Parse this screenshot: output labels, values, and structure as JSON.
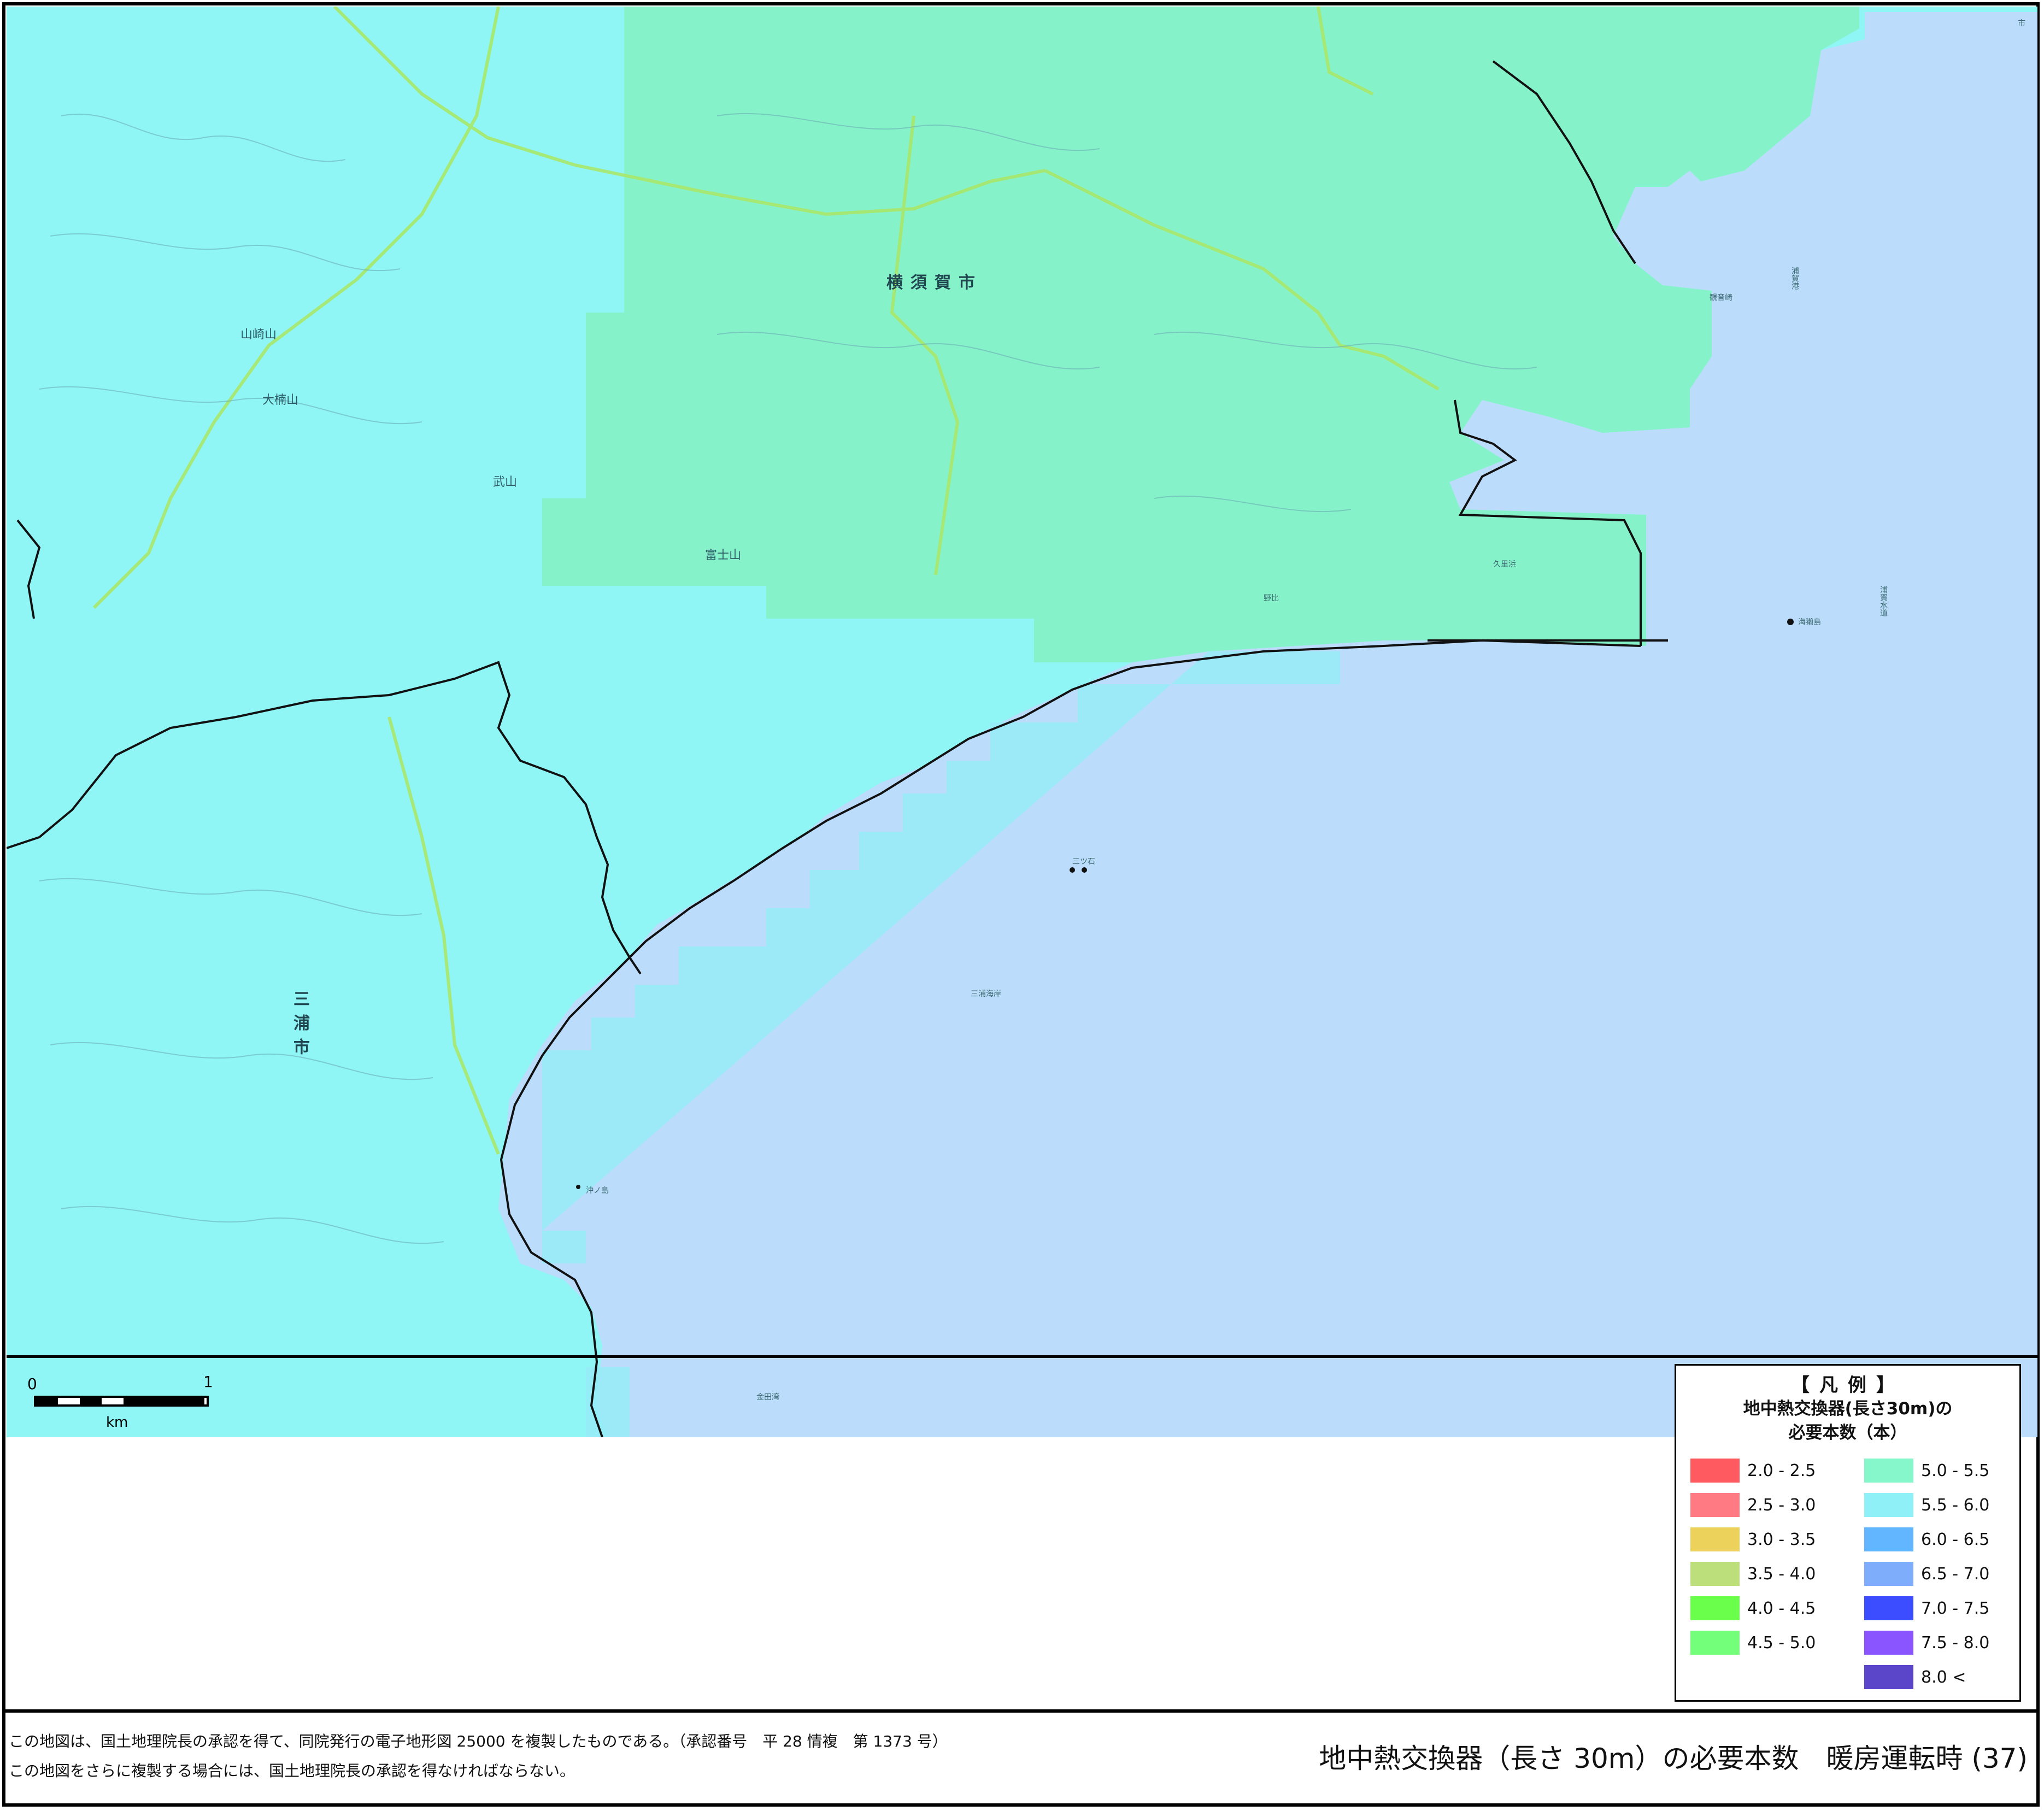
{
  "map": {
    "sheet_number_corner": "市",
    "place_labels": {
      "yokosuka": "横須賀市",
      "miura": "三浦市",
      "takeyama": "武山",
      "ogusuyama": "大楠山",
      "yamazakiyama": "山崎山",
      "fujiyama": "富士山",
      "miurakaigan": "三浦海岸",
      "kanadawan": "金田湾",
      "okinoshima": "沖ノ島",
      "mitsuishi": "三ツ石",
      "ashikajima": "海獺島",
      "uragasuido": "浦賀水道",
      "uragako": "浦賀港",
      "kannonzaki": "観音崎",
      "nojima": "野比",
      "kurihama": "久里浜"
    },
    "colors": {
      "sea": "#bcdcfc",
      "land_5_5_6_0": "#8ff5f5",
      "land_5_0_5_5": "#86f2c9",
      "coast_strip": "#97ecf7",
      "boundary": "#111111",
      "road": "#a8e86a"
    }
  },
  "scalebar": {
    "zero": "0",
    "one": "1",
    "unit": "km"
  },
  "legend": {
    "title": "【凡例】",
    "subtitle_line1": "地中熱交換器(長さ30m)の",
    "subtitle_line2": "必要本数（本）",
    "items": [
      {
        "label": "2.0 - 2.5",
        "color": "#ff5a5f"
      },
      {
        "label": "2.5 - 3.0",
        "color": "#ff7a82"
      },
      {
        "label": "3.0 - 3.5",
        "color": "#ecd15a"
      },
      {
        "label": "3.5 - 4.0",
        "color": "#bcdf7c"
      },
      {
        "label": "4.0 - 4.5",
        "color": "#6aff4a"
      },
      {
        "label": "4.5 - 5.0",
        "color": "#74ff7a"
      },
      {
        "label": "5.0 - 5.5",
        "color": "#86f7cb"
      },
      {
        "label": "5.5 - 6.0",
        "color": "#8ff0f8"
      },
      {
        "label": "6.0 - 6.5",
        "color": "#62b5ff"
      },
      {
        "label": "6.5 - 7.0",
        "color": "#7eaefb"
      },
      {
        "label": "7.0 - 7.5",
        "color": "#3b4dff"
      },
      {
        "label": "7.5 - 8.0",
        "color": "#8a55ff"
      },
      {
        "label": "8.0 <",
        "color": "#5b46c9"
      }
    ]
  },
  "footer": {
    "credit_line1": "この地図は、国土地理院長の承認を得て、同院発行の電子地形図 25000 を複製したものである。（承認番号　平 28 情複　第 1373 号）",
    "credit_line2": "この地図をさらに複製する場合には、国土地理院長の承認を得なければならない。",
    "title": "地中熱交換器（長さ 30m）の必要本数　暖房運転時 (37)"
  }
}
